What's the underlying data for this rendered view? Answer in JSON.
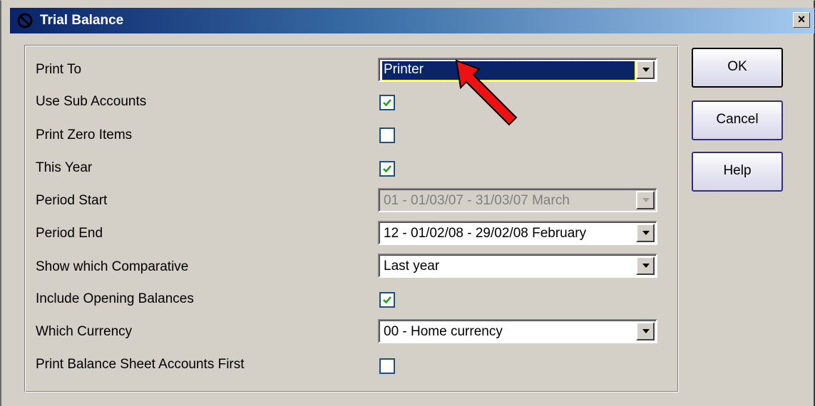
{
  "window": {
    "title": "Trial Balance",
    "close_symbol": "×"
  },
  "form": {
    "print_to": {
      "label": "Print To",
      "value": "Printer"
    },
    "use_sub_accounts": {
      "label": "Use Sub Accounts",
      "checked": true
    },
    "print_zero_items": {
      "label": "Print Zero Items",
      "checked": false
    },
    "this_year": {
      "label": "This Year",
      "checked": true
    },
    "period_start": {
      "label": "Period Start",
      "value": "01 - 01/03/07 - 31/03/07 March",
      "disabled": true
    },
    "period_end": {
      "label": "Period End",
      "value": "12 - 01/02/08 - 29/02/08 February"
    },
    "comparative": {
      "label": "Show which Comparative",
      "value": "Last year"
    },
    "opening_balances": {
      "label": "Include Opening Balances",
      "checked": true
    },
    "currency": {
      "label": "Which Currency",
      "value": "00 - Home currency"
    },
    "balance_sheet_first": {
      "label": "Print Balance Sheet Accounts First",
      "checked": false
    }
  },
  "buttons": {
    "ok": "OK",
    "cancel": "Cancel",
    "help": "Help"
  },
  "icons": {
    "window_icon": "app-logo-icon",
    "dropdown": "chevron-down-icon",
    "check": "check-icon",
    "annotation": "red-arrow-icon"
  },
  "colors": {
    "title_start": "#0a246a",
    "title_end": "#a6caf0",
    "check_green": "#21a121",
    "annotation_red": "#ee1111"
  }
}
